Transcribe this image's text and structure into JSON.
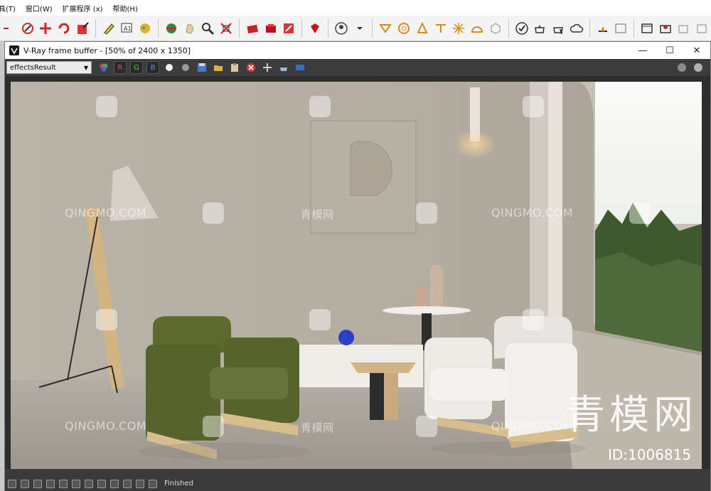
{
  "menu": [
    "具(T)",
    "窗口(W)",
    "扩展程序 (x)",
    "帮助(H)"
  ],
  "vfb": {
    "title": "V-Ray frame buffer - [50% of 2400 x 1350]",
    "channel": "effectsResult",
    "ch_r": "R",
    "ch_g": "G",
    "ch_b": "B",
    "status": "Finished",
    "minimize": "—",
    "maximize": "☐",
    "close": "✕"
  },
  "watermark": {
    "latin": "QINGMO.COM",
    "cn": "青模网",
    "big": "青模网",
    "id": "ID:1006815"
  },
  "colors": {
    "wall": "#b5afa5",
    "green_chair": "#5c6a2e",
    "white_chair": "#e9e7e2",
    "wood": "#d8bd8e"
  }
}
